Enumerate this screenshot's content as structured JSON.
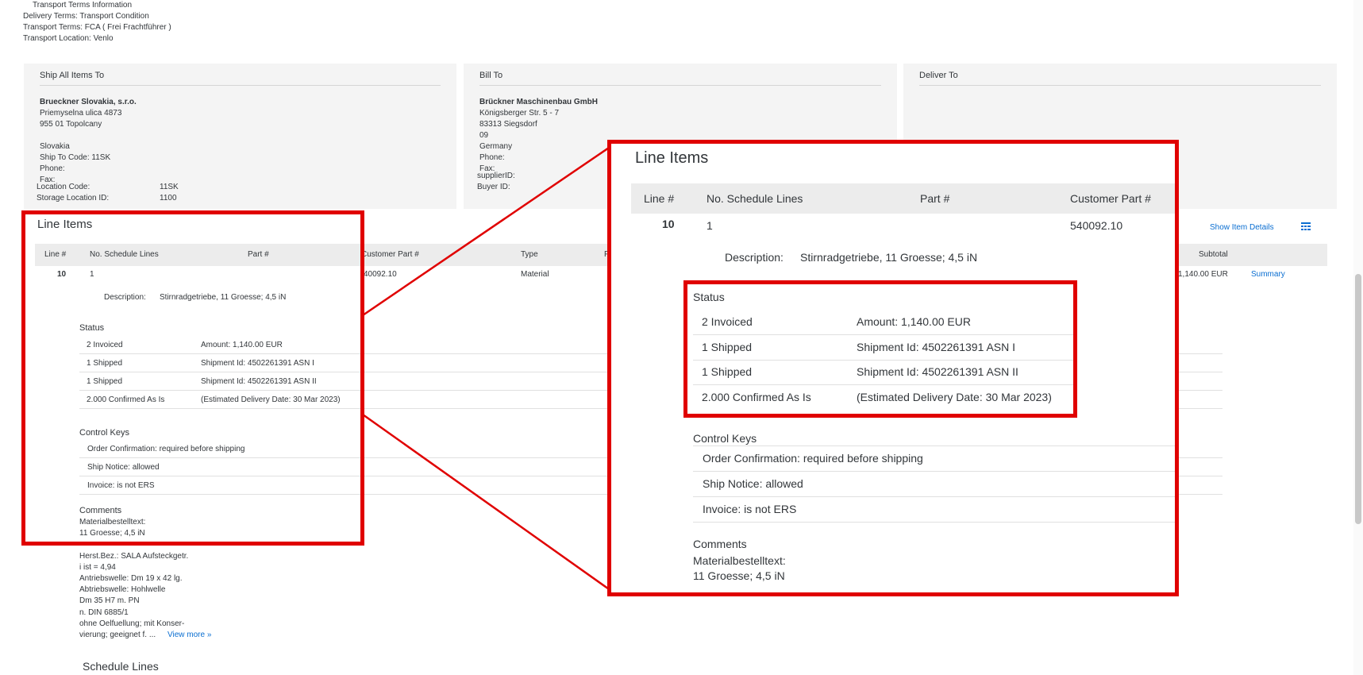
{
  "transport": {
    "title": "Transport Terms Information",
    "delivery_terms": "Delivery Terms: Transport Condition",
    "transport_terms": "Transport Terms: FCA  ( Frei Frachtführer )",
    "transport_location": "Transport Location: Venlo"
  },
  "ship_to": {
    "header": "Ship All Items To",
    "name": "Brueckner Slovakia, s.r.o.",
    "street": "Priemyselna ulica 4873",
    "city": "955 01 Topolcany",
    "country": "Slovakia",
    "ship_to_code": "Ship To Code:  11SK",
    "phone": "Phone:",
    "fax": "Fax:",
    "location_code_label": "Location Code:",
    "location_code_value": "11SK",
    "storage_label": "Storage Location ID:",
    "storage_value": "1100"
  },
  "bill_to": {
    "header": "Bill To",
    "name": "Brückner Maschinenbau GmbH",
    "street": "Königsberger Str. 5 - 7",
    "city": "83313 Siegsdorf",
    "region": "09",
    "country": "Germany",
    "phone": "Phone:",
    "fax": "Fax:",
    "supplier_id": "supplierID:",
    "buyer_id": "Buyer ID:"
  },
  "deliver_to": {
    "header": "Deliver To"
  },
  "line_items": {
    "title": "Line Items",
    "show_details": "Show Item Details",
    "columns": {
      "line": "Line #",
      "schedule": "No. Schedule Lines",
      "part": "Part #",
      "customer_part": "Customer Part #",
      "type": "Type",
      "col_p": "P",
      "subtotal": "Subtotal"
    },
    "row": {
      "line": "10",
      "schedule": "1",
      "customer_part": "540092.10",
      "customer_part_cut": "40092.10",
      "type": "Material",
      "subtotal": "1,140.00 EUR",
      "summary": "Summary"
    },
    "description_label": "Description:",
    "description_value": "Stirnradgetriebe, 11 Groesse; 4,5 iN",
    "status_title": "Status",
    "status": [
      {
        "state": "2 Invoiced",
        "info": "Amount:  1,140.00 EUR"
      },
      {
        "state": "1 Shipped",
        "info": "Shipment Id: 4502261391 ASN I"
      },
      {
        "state": "1 Shipped",
        "info": "Shipment Id: 4502261391 ASN II"
      },
      {
        "state": "2.000 Confirmed As Is",
        "info": "(Estimated Delivery Date: 30 Mar 2023)"
      }
    ],
    "control_keys_title": "Control Keys",
    "control_keys": [
      "Order Confirmation:  required before shipping",
      "Ship Notice:  allowed",
      "Invoice:  is not ERS"
    ],
    "comments_title": "Comments",
    "comments": [
      "Materialbestelltext:",
      "11 Groesse; 4,5 iN",
      "",
      "Herst.Bez.: SALA Aufsteckgetr.",
      "i ist = 4,94",
      "Antriebswelle: Dm 19 x 42 lg.",
      "Abtriebswelle: Hohlwelle",
      "Dm 35 H7 m. PN",
      "n. DIN 6885/1",
      "ohne Oelfuellung; mit Konser-"
    ],
    "comments_last": "vierung; geeignet f.  ...",
    "view_more": "View more »"
  },
  "schedule_lines": {
    "title": "Schedule Lines"
  },
  "colors": {
    "highlight": "#e00000",
    "link": "#0a6ed1",
    "panel": "#f4f4f4"
  }
}
